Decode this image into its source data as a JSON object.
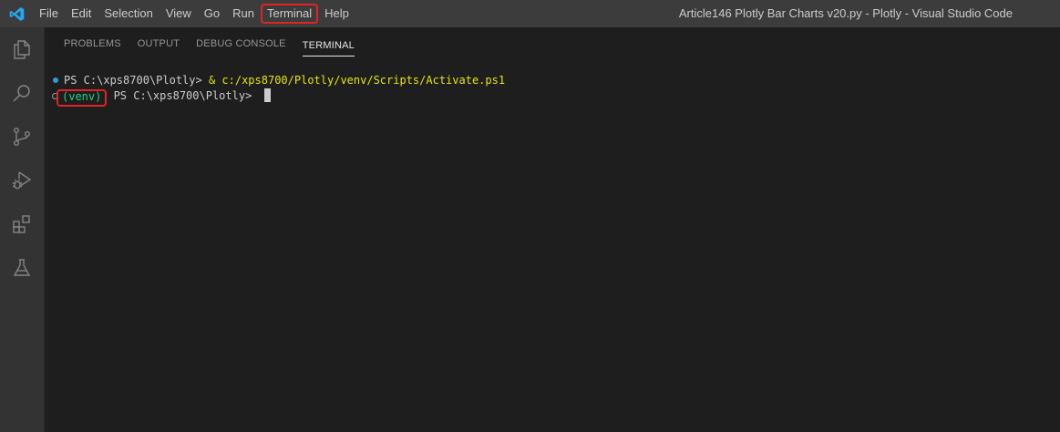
{
  "titlebar": {
    "menu": [
      "File",
      "Edit",
      "Selection",
      "View",
      "Go",
      "Run",
      "Terminal",
      "Help"
    ],
    "highlighted_menu": "Terminal",
    "window_title": "Article146 Plotly Bar Charts v20.py - Plotly - Visual Studio Code"
  },
  "activitybar": {
    "icons": [
      "explorer-icon",
      "search-icon",
      "source-control-icon",
      "run-debug-icon",
      "extensions-icon",
      "testing-icon"
    ]
  },
  "panel": {
    "tabs": [
      "PROBLEMS",
      "OUTPUT",
      "DEBUG CONSOLE",
      "TERMINAL"
    ],
    "active_tab": "TERMINAL"
  },
  "terminal": {
    "line1_prompt": "PS C:\\xps8700\\Plotly> ",
    "line1_command": "& c:/xps8700/Plotly/venv/Scripts/Activate.ps1",
    "line2_venv": "(venv)",
    "line2_prompt": " PS C:\\xps8700\\Plotly> "
  },
  "colors": {
    "accent_highlight": "#e02424",
    "terminal_yellow": "#e5e510",
    "terminal_green": "#23d18b",
    "vscode_blue": "#23a9f2"
  }
}
